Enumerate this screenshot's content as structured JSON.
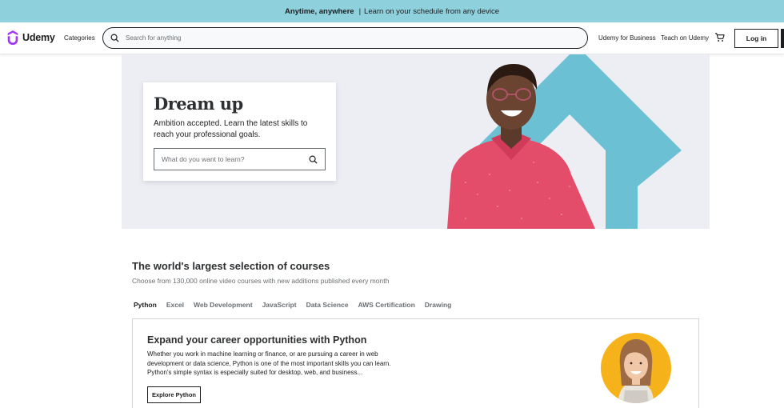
{
  "promo": {
    "highlight": "Anytime, anywhere",
    "separator": "|",
    "message": "Learn on your schedule from any device"
  },
  "header": {
    "logo_text": "Udemy",
    "categories_label": "Categories",
    "search_placeholder": "Search for anything",
    "business_link": "Udemy for Business",
    "teach_link": "Teach on Udemy",
    "login_label": "Log in"
  },
  "hero": {
    "title": "Dream up",
    "subtitle": "Ambition accepted. Learn the latest skills to reach your professional goals.",
    "search_placeholder": "What do you want to learn?"
  },
  "courses": {
    "title": "The world's largest selection of courses",
    "subtitle": "Choose from 130,000 online video courses with new additions published every month",
    "tabs": [
      "Python",
      "Excel",
      "Web Development",
      "JavaScript",
      "Data Science",
      "AWS Certification",
      "Drawing"
    ],
    "active_tab": "Python",
    "panel": {
      "title": "Expand your career opportunities with Python",
      "description": "Whether you work in machine learning or finance, or are pursuing a career in web development or data science, Python is one of the most important skills you can learn. Python's simple syntax is especially suited for desktop, web, and business...",
      "button_label": "Explore Python"
    }
  },
  "icons": {
    "search": "search-icon",
    "cart": "cart-icon",
    "logo": "udemy-logo-icon"
  },
  "colors": {
    "promo_bg": "#8ed1dc",
    "brand": "#a435f0",
    "hero_bg": "#eceef4",
    "accent_teal": "#6bc1d3",
    "shirt": "#e34d6a",
    "avatar_bg": "#f5b21a"
  }
}
